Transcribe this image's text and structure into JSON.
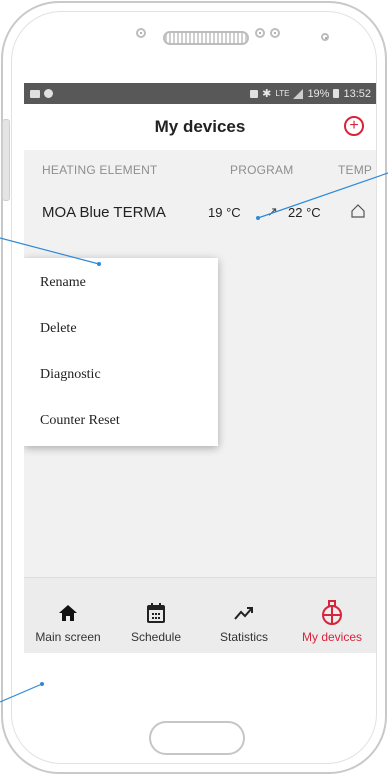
{
  "status_bar": {
    "battery": "19%",
    "time": "13:52",
    "network": "LTE"
  },
  "header": {
    "title": "My devices"
  },
  "columns": {
    "heating_element": "HEATING ELEMENT",
    "program": "PROGRAM",
    "temp": "TEMP"
  },
  "device": {
    "name": "MOA Blue TERMA",
    "current_temp": "19 °C",
    "target_temp": "22 °C"
  },
  "menu": {
    "items": [
      {
        "label": "Rename"
      },
      {
        "label": "Delete"
      },
      {
        "label": "Diagnostic"
      },
      {
        "label": "Counter Reset"
      }
    ]
  },
  "tabs": [
    {
      "label": "Main screen",
      "icon": "home-icon"
    },
    {
      "label": "Schedule",
      "icon": "calendar-icon"
    },
    {
      "label": "Statistics",
      "icon": "trend-icon"
    },
    {
      "label": "My devices",
      "icon": "radiator-icon"
    }
  ],
  "colors": {
    "accent": "#d8243a",
    "status_bar": "#585858",
    "callout": "#2e8ad8"
  }
}
